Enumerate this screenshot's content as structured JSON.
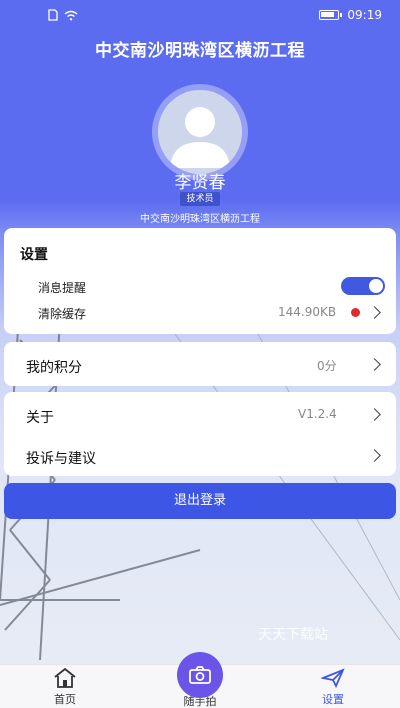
{
  "status_bar": {
    "time": "09:19"
  },
  "header": {
    "title": "中交南沙明珠湾区横沥工程"
  },
  "profile": {
    "name": "李贤春",
    "role": "技术员",
    "project": "中交南沙明珠湾区横沥工程"
  },
  "settings": {
    "title": "设置",
    "message_reminder_label": "消息提醒",
    "message_reminder_on": true,
    "clear_cache_label": "清除缓存",
    "cache_size": "144.90KB"
  },
  "points": {
    "label": "我的积分",
    "value": "0分"
  },
  "about": {
    "label": "关于",
    "version": "V1.2.4"
  },
  "feedback": {
    "label": "投诉与建议"
  },
  "logout": {
    "label": "退出登录"
  },
  "watermark": "天天下载站",
  "tabbar": {
    "home": "首页",
    "snap": "随手拍",
    "settings": "设置"
  },
  "colors": {
    "primary": "#3e56e6",
    "header_bg": "#5b6cf0",
    "notification_dot": "#e3272d"
  },
  "icons": {
    "home": "home-icon",
    "camera": "camera-icon",
    "settings": "airplane-icon",
    "wifi": "wifi-icon",
    "sim": "sim-icon",
    "battery": "battery-icon"
  }
}
